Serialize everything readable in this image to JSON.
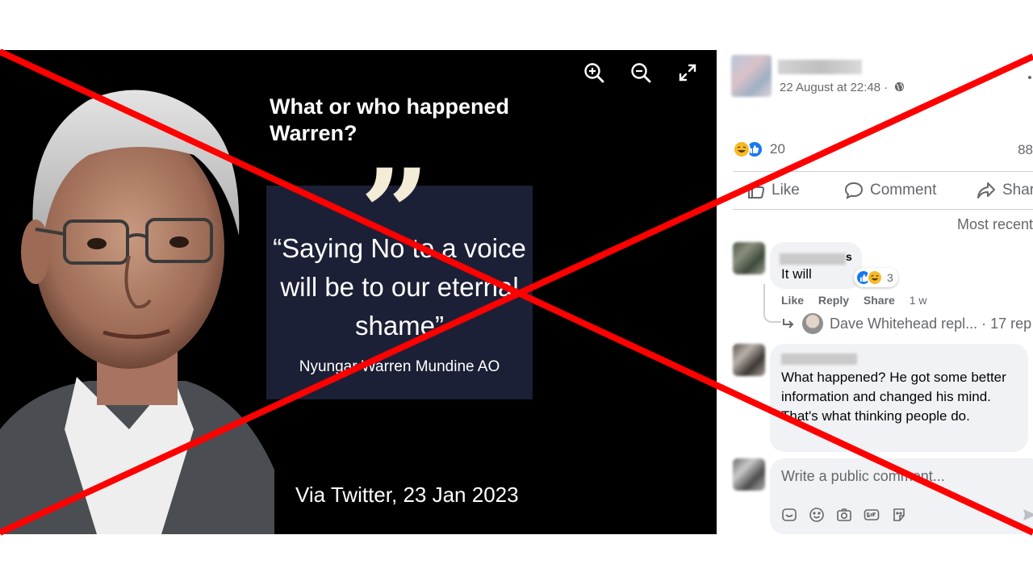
{
  "viewer": {
    "image": {
      "headline": "What or who happened Warren?",
      "quote": "“Saying No to a voice will be to our eternal shame”",
      "quote_author": "Nyungar Warren Mundine AO",
      "source": "Via Twitter, 23 Jan 2023"
    },
    "tools": [
      "zoom-in-icon",
      "zoom-out-icon",
      "fullscreen-icon"
    ]
  },
  "post": {
    "timestamp": "22 August at 22:48 ·",
    "reaction_count": "20",
    "comment_count": "88",
    "actions": {
      "like": "Like",
      "comment": "Comment",
      "share": "Shar"
    },
    "sort_label": "Most recent"
  },
  "comments": [
    {
      "name_visible": "s",
      "text": "It will",
      "reaction_count": "3",
      "links": {
        "like": "Like",
        "reply": "Reply",
        "share": "Share",
        "age": "1 w"
      },
      "reply_summary": "Dave Whitehead repl... · 17 rep"
    },
    {
      "text": "What happened? He got some better information and changed his mind. That's what thinking people do."
    }
  ],
  "composer": {
    "placeholder": "Write a public comment..."
  },
  "colors": {
    "overlay_cross": "#ff0000",
    "accent": "#1877f2",
    "muted_text": "#65676b"
  }
}
